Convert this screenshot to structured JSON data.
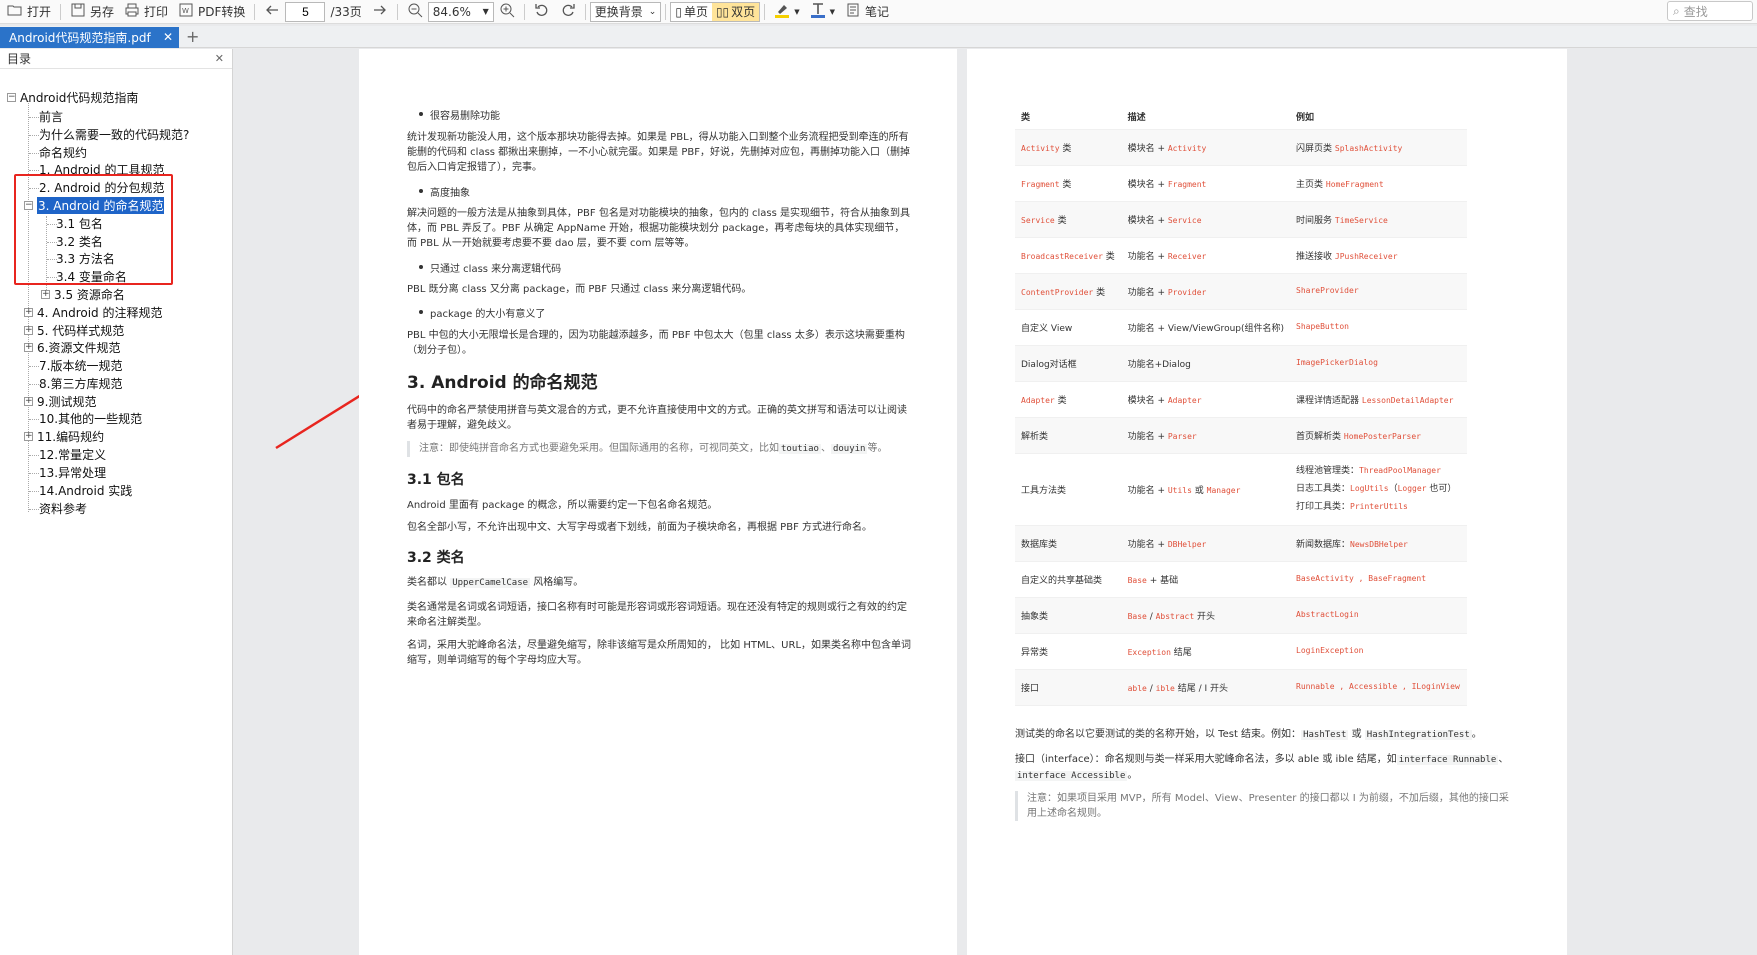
{
  "toolbar": {
    "open": "打开",
    "save_as": "另存",
    "print": "打印",
    "pdf_convert": "PDF转换",
    "page_current": "5",
    "page_total": "/33页",
    "zoom": "84.6%",
    "background": "更换背景",
    "single_page": "单页",
    "double_page": "双页",
    "notes": "笔记",
    "search_placeholder": "查找"
  },
  "tab": {
    "title": "Android代码规范指南.pdf"
  },
  "sidebar": {
    "title": "目录",
    "root": "Android代码规范指南",
    "items": [
      "前言",
      "为什么需要一致的代码规范?",
      "命名规约",
      "1. Android 的工具规范",
      "2. Android 的分包规范",
      "3. Android 的命名规范",
      "3.1 包名",
      "3.2 类名",
      "3.3 方法名",
      "3.4 变量命名",
      "3.5 资源命名",
      "4. Android 的注释规范",
      "5. 代码样式规范",
      "6.资源文件规范",
      "7.版本统一规范",
      "8.第三方库规范",
      "9.测试规范",
      "10.其他的一些规范",
      "11.编码规约",
      "12.常量定义",
      "13.异常处理",
      "14.Android 实践",
      "资料参考"
    ]
  },
  "page1": {
    "b1": "很容易删除功能",
    "p1": "统计发现新功能没人用，这个版本那块功能得去掉。如果是 PBL，得从功能入口到整个业务流程把受到牵连的所有能删的代码和 class 都揪出来删掉，一不小心就完蛋。如果是 PBF，好说，先删掉对应包，再删掉功能入口（删掉包后入口肯定报错了），完事。",
    "b2": "高度抽象",
    "p2": "解决问题的一般方法是从抽象到具体，PBF 包名是对功能模块的抽象，包内的 class 是实现细节，符合从抽象到具体，而 PBL 弄反了。PBF 从确定 AppName 开始，根据功能模块划分 package，再考虑每块的具体实现细节，而 PBL 从一开始就要考虑要不要 dao 层，要不要 com 层等等。",
    "b3": "只通过 class 来分离逻辑代码",
    "p3": "PBL 既分离 class 又分离 package，而 PBF 只通过 class 来分离逻辑代码。",
    "b4": "package 的大小有意义了",
    "p4": "PBL 中包的大小无限增长是合理的，因为功能越添越多，而 PBF 中包太大（包里 class 太多）表示这块需要重构（划分子包）。",
    "h_naming": "3. Android 的命名规范",
    "p5": "代码中的命名严禁使用拼音与英文混合的方式，更不允许直接使用中文的方式。正确的英文拼写和语法可以让阅读者易于理解，避免歧义。",
    "note1_a": "注意：即使纯拼音命名方式也要避免采用。但国际通用的名称，可视同英文，比如",
    "note1_c1": "toutiao",
    "note1_sep": "、",
    "note1_c2": "douyin",
    "note1_b": "等。",
    "h_pkg": "3.1 包名",
    "p6": "Android 里面有 package 的概念，所以需要约定一下包名命名规范。",
    "p7": "包名全部小写，不允许出现中文、大写字母或者下划线，前面为子模块命名，再根据 PBF 方式进行命名。",
    "h_class": "3.2 类名",
    "p8_a": "类名都以",
    "p8_code": "UpperCamelCase",
    "p8_b": "风格编写。",
    "p9": "类名通常是名词或名词短语，接口名称有时可能是形容词或形容词短语。现在还没有特定的规则或行之有效的约定来命名注解类型。",
    "p10": "名词，采用大驼峰命名法，尽量避免缩写，除非该缩写是众所周知的， 比如 HTML、URL，如果类名称中包含单词缩写，则单词缩写的每个字母均应大写。"
  },
  "page2": {
    "headers": [
      "类",
      "描述",
      "例如"
    ],
    "rows": [
      {
        "c1": "Activity",
        "c1t": " 类",
        "c2a": "模块名 + ",
        "c2r": "Activity",
        "c3a": "闪屏页类 ",
        "c3r": "SplashActivity"
      },
      {
        "c1": "Fragment",
        "c1t": " 类",
        "c2a": "模块名 + ",
        "c2r": "Fragment",
        "c3a": "主页类 ",
        "c3r": "HomeFragment"
      },
      {
        "c1": "Service",
        "c1t": " 类",
        "c2a": "模块名 + ",
        "c2r": "Service",
        "c3a": "时间服务 ",
        "c3r": "TimeService"
      },
      {
        "c1": "BroadcastReceiver",
        "c1t": " 类",
        "c2a": "功能名 + ",
        "c2r": "Receiver",
        "c3a": "推送接收 ",
        "c3r": "JPushReceiver"
      },
      {
        "c1": "ContentProvider",
        "c1t": " 类",
        "c2a": "功能名 + ",
        "c2r": "Provider",
        "c3a": "",
        "c3r": "ShareProvider"
      },
      {
        "c1": "",
        "c1t": "自定义 View",
        "c2a": "功能名 + View/ViewGroup(组件名称)",
        "c2r": "",
        "c3a": "",
        "c3r": "ShapeButton"
      },
      {
        "c1": "",
        "c1t": "Dialog对话框",
        "c2a": "功能名+Dialog",
        "c2r": "",
        "c3a": "",
        "c3r": "ImagePickerDialog"
      },
      {
        "c1": "Adapter",
        "c1t": " 类",
        "c2a": "模块名 + ",
        "c2r": "Adapter",
        "c3a": "课程详情适配器 ",
        "c3r": "LessonDetailAdapter"
      },
      {
        "c1": "",
        "c1t": "解析类",
        "c2a": "功能名 + ",
        "c2r": "Parser",
        "c3a": "首页解析类 ",
        "c3r": "HomePosterParser"
      },
      {
        "c1": "",
        "c1t": "数据库类",
        "c2a": "功能名 + ",
        "c2r": "DBHelper",
        "c3a": "新闻数据库：",
        "c3r": "NewsDBHelper"
      },
      {
        "c1": "",
        "c1t": "自定义的共享基础类",
        "c2a": "",
        "c2r": "Base",
        "c3a": "",
        "c3r": "BaseActivity , BaseFragment"
      },
      {
        "c1": "",
        "c1t": "抽象类",
        "c2a": "",
        "c2r": "Base",
        "c3a": "",
        "c3r": "AbstractLogin"
      },
      {
        "c1": "",
        "c1t": "异常类",
        "c2a": "",
        "c2r": "Exception",
        "c3a": "",
        "c3r": "LoginException"
      },
      {
        "c1": "",
        "c1t": "接口",
        "c2a": "",
        "c2r": "able",
        "c3a": "",
        "c3r": "Runnable , Accessible , ILoginView"
      }
    ],
    "tool_row": {
      "c1t": "工具方法类",
      "c2a": "功能名 + ",
      "c2r1": "Utils",
      "c2m": " 或 ",
      "c2r2": "Manager",
      "l1a": "线程池管理类：",
      "l1r": "ThreadPoolManager",
      "l2a": "日志工具类：",
      "l2r": "LogUtils",
      "l2b": "（",
      "l2r2": "Logger",
      "l2c": " 也可）",
      "l3a": "打印工具类：",
      "l3r": "PrinterUtils"
    },
    "base_suffix": " + 基础",
    "abstract_sep": " / ",
    "abstract_r2": "Abstract",
    "abstract_suffix": " 开头",
    "exception_suffix": " 结尾",
    "iface_sep": " / ",
    "iface_r2": "ible",
    "iface_suffix": " 结尾 / I 开头",
    "p_test_a": "测试类的命名以它要测试的类的名称开始，以 Test 结束。例如：",
    "p_test_c1": "HashTest",
    "p_test_m": " 或 ",
    "p_test_c2": "HashIntegrationTest",
    "p_test_b": "。",
    "p_iface_a": "接口（interface）：命名规则与类一样采用大驼峰命名法，多以 able 或 ible 结尾，如",
    "p_iface_c1": "interface Runnable",
    "p_iface_m": "、",
    "p_iface_c2": "interface Accessible",
    "p_iface_b": "。",
    "note2": "注意：如果项目采用 MVP，所有 Model、View、Presenter 的接口都以 I 为前缀，不加后缀，其他的接口采用上述命名规则。"
  },
  "colors": {
    "accent": "#2b73c9",
    "selection": "#1e64c8",
    "annotation": "#e8251f",
    "code_red": "#e0503a"
  }
}
